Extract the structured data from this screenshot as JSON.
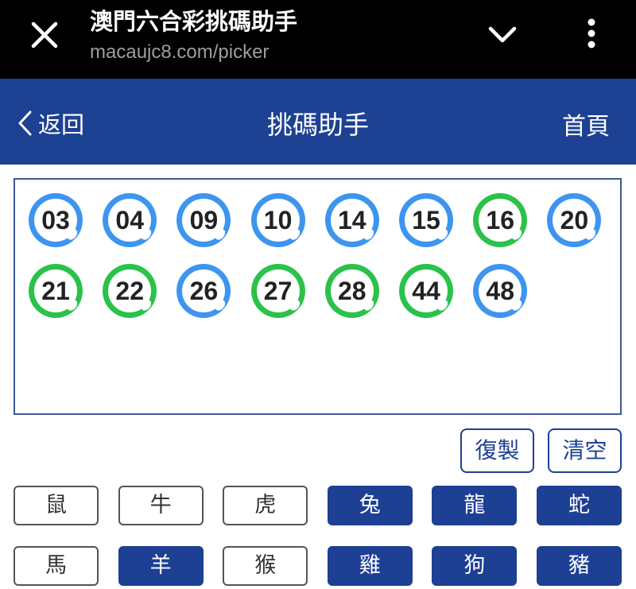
{
  "browser": {
    "page_title": "澳門六合彩挑碼助手",
    "url": "macaujc8.com/picker"
  },
  "nav": {
    "back_label": "返回",
    "title": "挑碼助手",
    "home_label": "首頁"
  },
  "colors": {
    "blue_ball": "#3d95f0",
    "green_ball": "#2bc24a",
    "nav_bg": "#1d4193"
  },
  "picked_numbers": [
    {
      "num": "03",
      "color": "blue"
    },
    {
      "num": "04",
      "color": "blue"
    },
    {
      "num": "09",
      "color": "blue"
    },
    {
      "num": "10",
      "color": "blue"
    },
    {
      "num": "14",
      "color": "blue"
    },
    {
      "num": "15",
      "color": "blue"
    },
    {
      "num": "16",
      "color": "green"
    },
    {
      "num": "20",
      "color": "blue"
    },
    {
      "num": "21",
      "color": "green"
    },
    {
      "num": "22",
      "color": "green"
    },
    {
      "num": "26",
      "color": "blue"
    },
    {
      "num": "27",
      "color": "green"
    },
    {
      "num": "28",
      "color": "green"
    },
    {
      "num": "44",
      "color": "green"
    },
    {
      "num": "48",
      "color": "blue"
    }
  ],
  "actions": {
    "copy_label": "復製",
    "clear_label": "清空"
  },
  "zodiacs": [
    {
      "label": "鼠",
      "selected": false
    },
    {
      "label": "牛",
      "selected": false
    },
    {
      "label": "虎",
      "selected": false
    },
    {
      "label": "兔",
      "selected": true
    },
    {
      "label": "龍",
      "selected": true
    },
    {
      "label": "蛇",
      "selected": true
    },
    {
      "label": "馬",
      "selected": false
    },
    {
      "label": "羊",
      "selected": true
    },
    {
      "label": "猴",
      "selected": false
    },
    {
      "label": "雞",
      "selected": true
    },
    {
      "label": "狗",
      "selected": true
    },
    {
      "label": "豬",
      "selected": true
    }
  ]
}
